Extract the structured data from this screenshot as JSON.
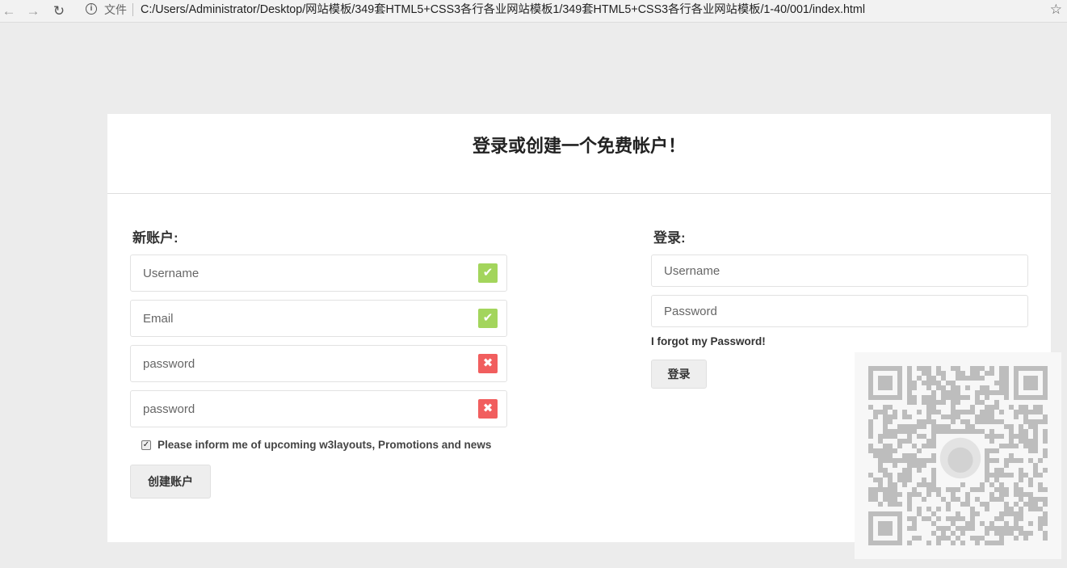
{
  "browser": {
    "file_label": "文件",
    "url": "C:/Users/Administrator/Desktop/网站模板/349套HTML5+CSS3各行各业网站模板1/349套HTML5+CSS3各行各业网站模板/1-40/001/index.html",
    "icons": [
      "back-arrow-icon",
      "forward-arrow-icon",
      "reload-icon",
      "info-icon",
      "star-icon"
    ]
  },
  "page": {
    "heading": "登录或创建一个免费帐户！"
  },
  "register": {
    "title": "新账户:",
    "fields": [
      {
        "placeholder": "Username",
        "status": "valid",
        "status_icon": "check-icon"
      },
      {
        "placeholder": "Email",
        "status": "valid",
        "status_icon": "check-icon"
      },
      {
        "placeholder": "password",
        "status": "invalid",
        "status_icon": "cross-icon"
      },
      {
        "placeholder": "password",
        "status": "invalid",
        "status_icon": "cross-icon"
      }
    ],
    "newsletter_label": "Please inform me of upcoming w3layouts, Promotions and news",
    "newsletter_checked": true,
    "submit_label": "创建账户"
  },
  "login": {
    "title": "登录:",
    "username_placeholder": "Username",
    "password_placeholder": "Password",
    "forgot_label": "I forgot my Password!",
    "submit_label": "登录"
  },
  "colors": {
    "valid": "#a3d55c",
    "invalid": "#f15e5e",
    "page_bg": "#ececec"
  }
}
